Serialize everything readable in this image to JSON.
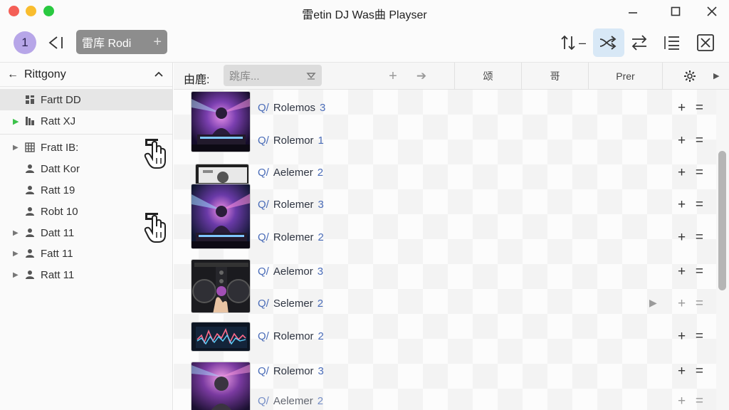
{
  "window": {
    "title": "雷etin DJ Was曲 Playser"
  },
  "toolbar": {
    "avatar_label": "1",
    "library_label": "雷库 Rodi"
  },
  "sidebar": {
    "header": "Rittgony",
    "items": [
      {
        "label": "Fartt DD",
        "icon": "grid-icon",
        "expand": "none",
        "selected": true
      },
      {
        "label": "Ratt XJ",
        "icon": "library-icon",
        "expand": "play-green"
      },
      {
        "label": "Fratt IB:",
        "icon": "columns-icon",
        "expand": "chevron"
      },
      {
        "label": "Datt Kor",
        "icon": "person-icon",
        "expand": "none"
      },
      {
        "label": "Ratt 19",
        "icon": "person-icon",
        "expand": "none"
      },
      {
        "label": "Robt 10",
        "icon": "person-icon",
        "expand": "none"
      },
      {
        "label": "Datt 11",
        "icon": "person-icon",
        "expand": "chevron"
      },
      {
        "label": "Fatt 11",
        "icon": "person-icon",
        "expand": "chevron"
      },
      {
        "label": "Ratt 11",
        "icon": "person-icon",
        "expand": "chevron"
      }
    ]
  },
  "filterbar": {
    "label": "由鹿:",
    "select_value": "跳库...",
    "columns": [
      "颂",
      "哥",
      "Prer"
    ]
  },
  "tracks": [
    {
      "prefix": "Q/",
      "name": "Rolemos",
      "num": "3"
    },
    {
      "prefix": "Q/",
      "name": "Rolemor",
      "num": "1"
    },
    {
      "prefix": "Q/",
      "name": "Aelemer",
      "num": "2"
    },
    {
      "prefix": "Q/",
      "name": "Rolemer",
      "num": "3"
    },
    {
      "prefix": "Q/",
      "name": "Rolemer",
      "num": "2"
    },
    {
      "prefix": "Q/",
      "name": "Aelemor",
      "num": "3"
    },
    {
      "prefix": "Q/",
      "name": "Selemer",
      "num": "2"
    },
    {
      "prefix": "Q/",
      "name": "Rolemor",
      "num": "2"
    },
    {
      "prefix": "Q/",
      "name": "Rolemor",
      "num": "3"
    },
    {
      "prefix": "Q/",
      "name": "Aelemer",
      "num": "2"
    }
  ],
  "colors": {
    "accent": "#4a6cb8",
    "avatar": "#b7a6e8",
    "active_tool": "#d8e8f6",
    "play_green": "#3cc24a"
  }
}
